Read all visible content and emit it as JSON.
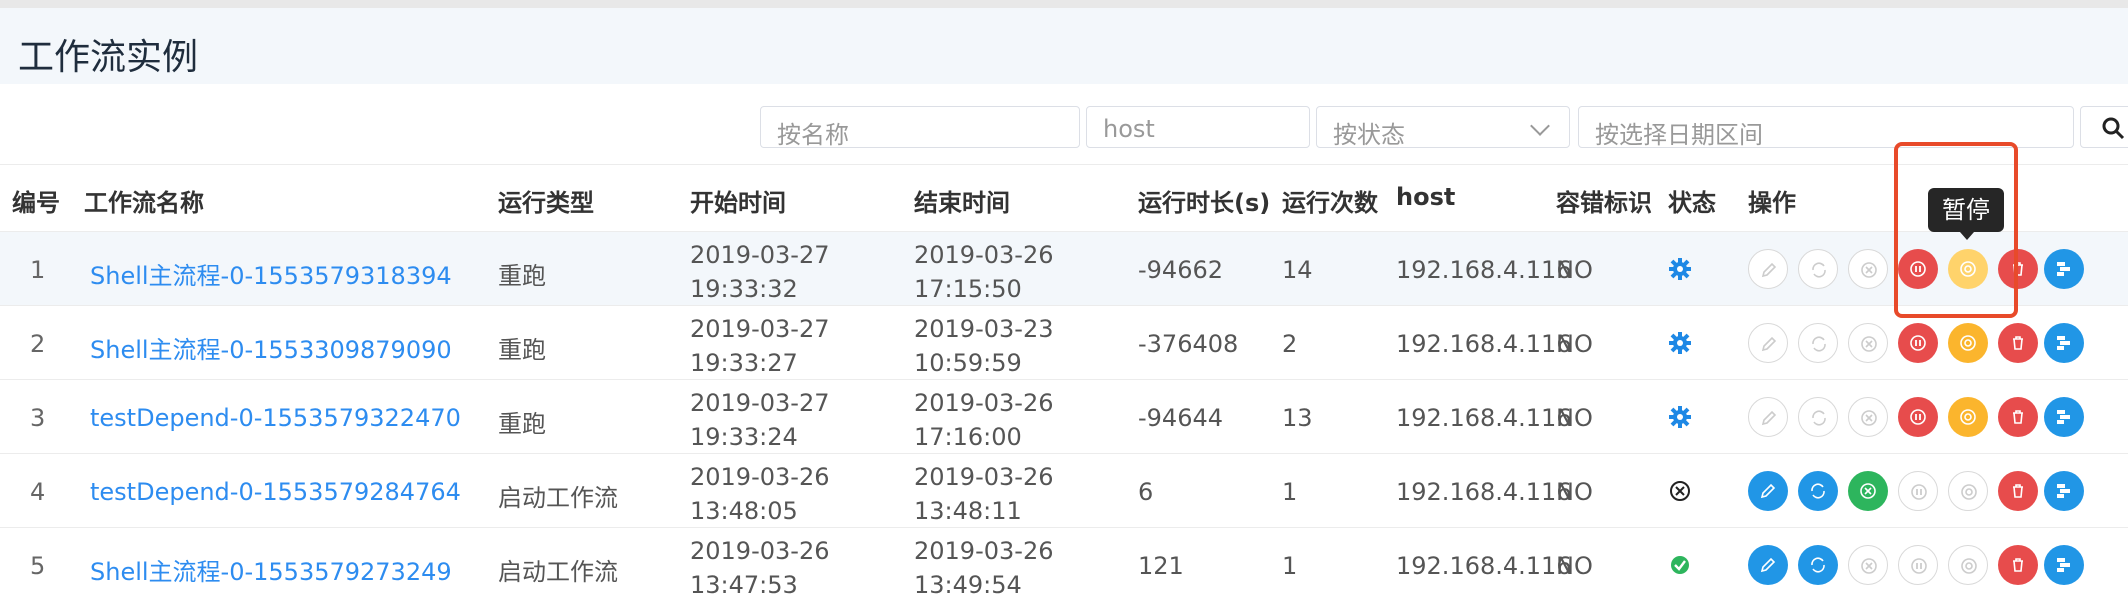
{
  "page": {
    "title": "工作流实例"
  },
  "filters": {
    "name_placeholder": "按名称",
    "host_placeholder": "host",
    "status_placeholder": "按状态",
    "date_placeholder": "按选择日期区间"
  },
  "columns": [
    "编号",
    "工作流名称",
    "运行类型",
    "开始时间",
    "结束时间",
    "运行时长(s)",
    "运行次数",
    "host",
    "容错标识",
    "状态",
    "操作"
  ],
  "tooltip": "暂停",
  "rows": [
    {
      "id": "1",
      "name": "Shell主流程-0-1553579318394",
      "run_type": "重跑",
      "start_date": "2019-03-27",
      "start_time": "19:33:32",
      "end_date": "2019-03-26",
      "end_time": "17:15:50",
      "duration": "-94662",
      "run_count": "14",
      "host": "192.168.4.116",
      "fault_tolerant": "NO",
      "status_icon": "running-gear-icon"
    },
    {
      "id": "2",
      "name": "Shell主流程-0-1553309879090",
      "run_type": "重跑",
      "start_date": "2019-03-27",
      "start_time": "19:33:27",
      "end_date": "2019-03-23",
      "end_time": "10:59:59",
      "duration": "-376408",
      "run_count": "2",
      "host": "192.168.4.116",
      "fault_tolerant": "NO",
      "status_icon": "running-gear-icon"
    },
    {
      "id": "3",
      "name": "testDepend-0-1553579322470",
      "run_type": "重跑",
      "start_date": "2019-03-27",
      "start_time": "19:33:24",
      "end_date": "2019-03-26",
      "end_time": "17:16:00",
      "duration": "-94644",
      "run_count": "13",
      "host": "192.168.4.116",
      "fault_tolerant": "NO",
      "status_icon": "running-gear-icon"
    },
    {
      "id": "4",
      "name": "testDepend-0-1553579284764",
      "run_type": "启动工作流",
      "start_date": "2019-03-26",
      "start_time": "13:48:05",
      "end_date": "2019-03-26",
      "end_time": "13:48:11",
      "duration": "6",
      "run_count": "1",
      "host": "192.168.4.116",
      "fault_tolerant": "NO",
      "status_icon": "failed-x-icon"
    },
    {
      "id": "5",
      "name": "Shell主流程-0-1553579273249",
      "run_type": "启动工作流",
      "start_date": "2019-03-26",
      "start_time": "13:47:53",
      "end_date": "2019-03-26",
      "end_time": "13:49:54",
      "duration": "121",
      "run_count": "1",
      "host": "192.168.4.116",
      "fault_tolerant": "NO",
      "status_icon": "success-check-icon"
    }
  ],
  "colors": {
    "link": "#2d8cf0",
    "blue": "#2196e6",
    "red": "#e74c4c",
    "yellow": "#fbb52d",
    "green": "#2db55d",
    "highlight_box": "#e84a2a"
  }
}
